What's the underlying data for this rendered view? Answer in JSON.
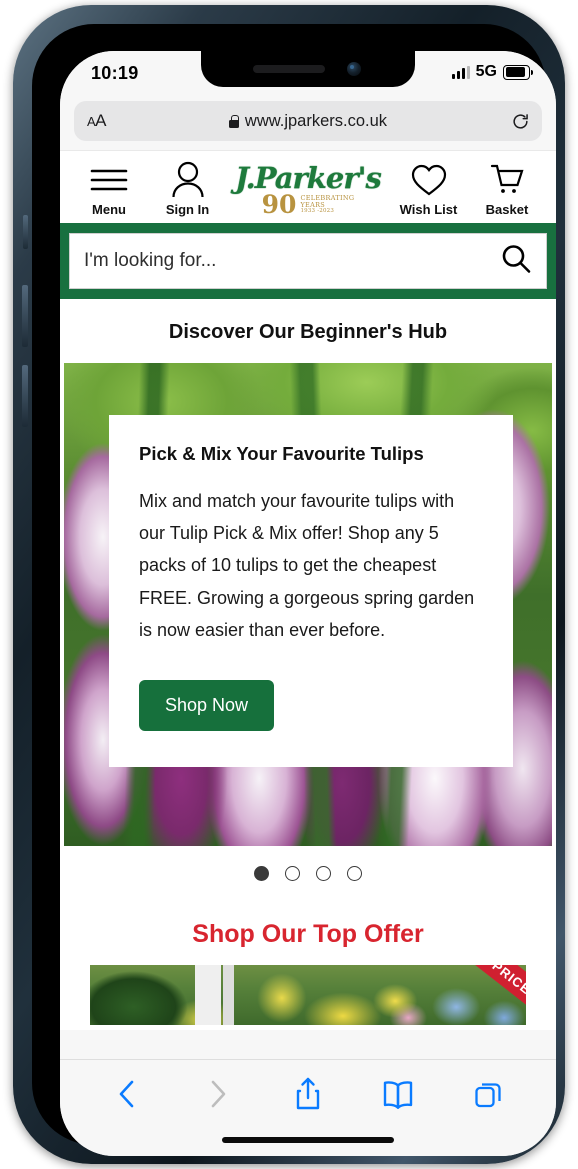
{
  "status": {
    "time": "10:19",
    "network": "5G",
    "signal_bars_filled": 3,
    "signal_bars_total": 4,
    "battery_full": true
  },
  "browser": {
    "text_size_label": "AA",
    "url": "www.jparkers.co.uk",
    "lock_icon": "lock-icon",
    "reload_icon": "reload-icon",
    "toolbar": {
      "back_label": "back-icon",
      "forward_label": "forward-icon",
      "share_label": "share-icon",
      "bookmarks_label": "bookmarks-icon",
      "tabs_label": "tabs-icon"
    }
  },
  "topnav": {
    "menu_label": "Menu",
    "signin_label": "Sign In",
    "wishlist_label": "Wish List",
    "basket_label": "Basket",
    "logo": {
      "script": "J.Parker's",
      "anniversary": "90",
      "line1": "CELEBRATING",
      "line2": "YEARS",
      "line3": "1933 -2023",
      "green": "#1e7a3c",
      "gold": "#b89340"
    }
  },
  "search": {
    "placeholder": "I'm looking for...",
    "value": "",
    "band_color": "#18703f",
    "icon": "search-icon"
  },
  "sections": {
    "beginners_hub_title": "Discover Our Beginner's Hub",
    "top_offer_title": "Shop Our Top Offer",
    "top_offer_color": "#d8252f",
    "top_offer_ribbon": "HALF PRICE"
  },
  "hero": {
    "card_title": "Pick & Mix Your Favourite Tulips",
    "card_body": "Mix and match your favourite tulips with our Tulip Pick & Mix offer! Shop any 5 packs of 10 tulips to get the cheapest FREE. Growing a gorgeous spring garden is now easier than ever before.",
    "cta_label": "Shop Now",
    "cta_color": "#16703c",
    "image_alt": "purple-and-white-tulips-photo",
    "carousel": {
      "total_dots": 4,
      "active_index": 0
    }
  }
}
